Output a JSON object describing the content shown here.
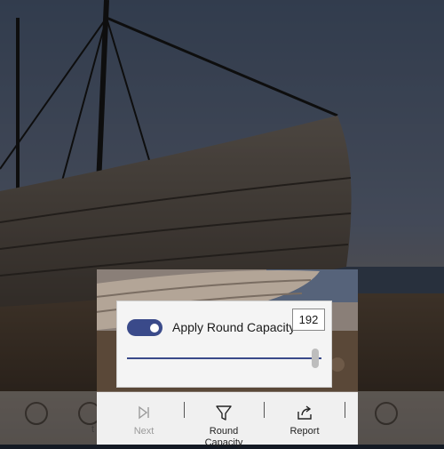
{
  "panel": {
    "toggle_on": true,
    "label": "Apply Round Capacity",
    "value": "192",
    "slider_fraction": 0.97
  },
  "toolbar": {
    "items": [
      {
        "label": "Next",
        "icon": "skip-next-icon",
        "enabled": false
      },
      {
        "label": "Round Capacity",
        "icon": "filter-funnel-icon",
        "enabled": true
      },
      {
        "label": "Report",
        "icon": "share-export-icon",
        "enabled": true
      }
    ]
  },
  "background_toolbar": {
    "partial_label": "t"
  },
  "colors": {
    "accent": "#3a4a8a",
    "panel_bg": "#f4f4f4",
    "toolbar_bg": "#f0f0f0"
  }
}
